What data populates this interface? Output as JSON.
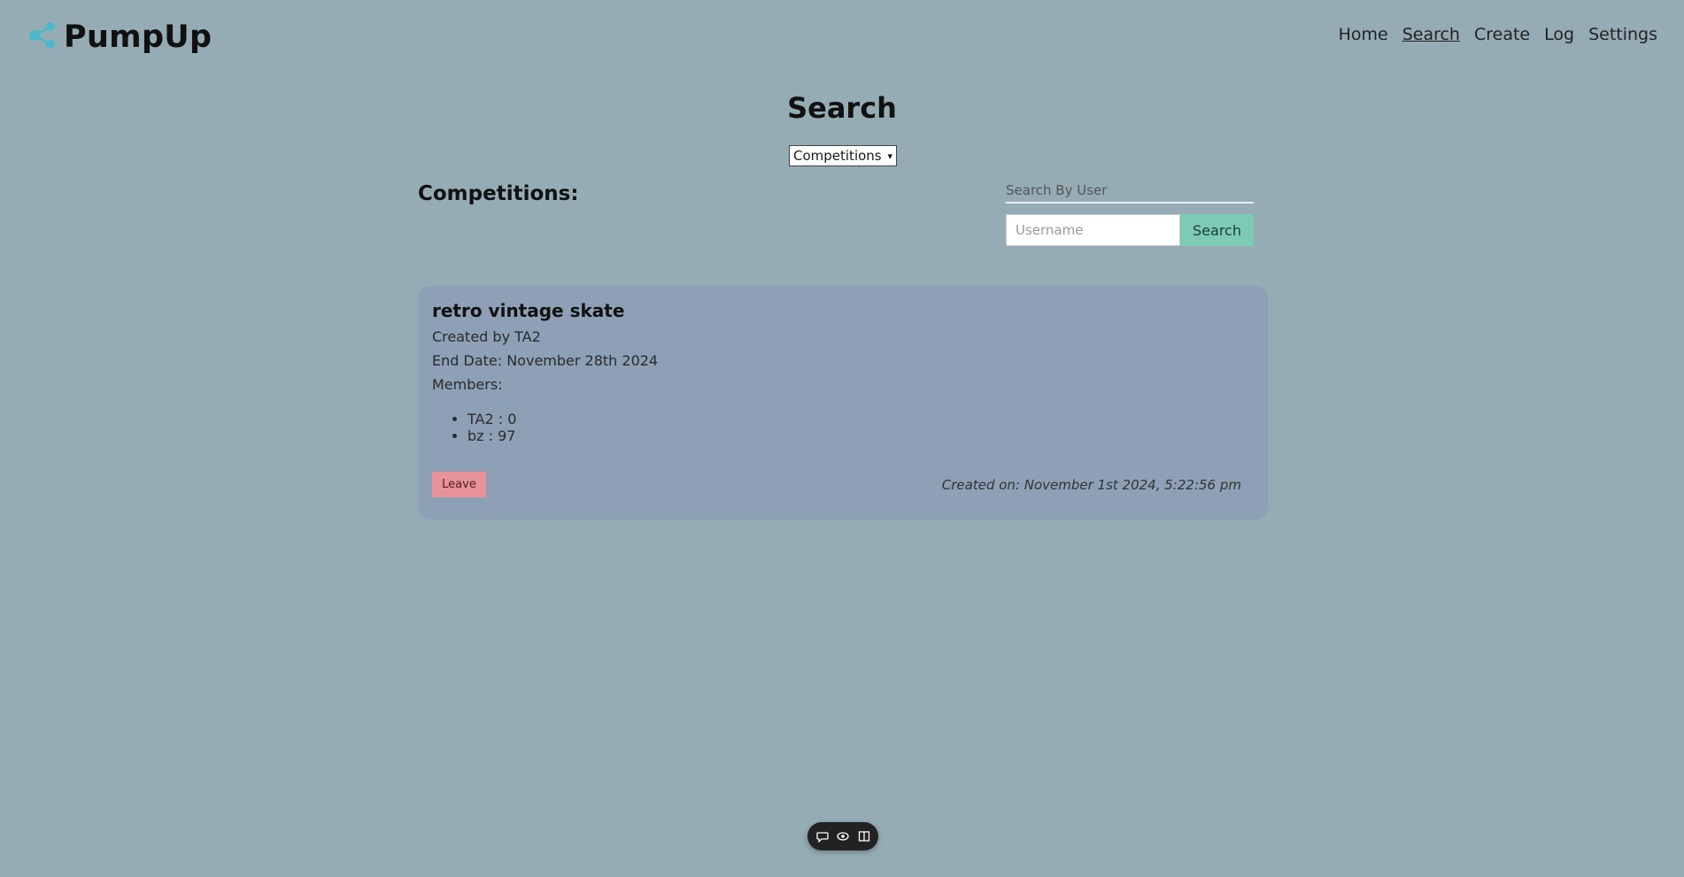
{
  "header": {
    "app_name": "PumpUp",
    "logo_icon": "share-icon",
    "brand_color": "#4ab8c9",
    "nav": [
      {
        "label": "Home",
        "active": false
      },
      {
        "label": "Search",
        "active": true
      },
      {
        "label": "Create",
        "active": false
      },
      {
        "label": "Log",
        "active": false
      },
      {
        "label": "Settings",
        "active": false
      }
    ]
  },
  "page": {
    "title": "Search",
    "type_select": {
      "selected": "Competitions"
    },
    "section_heading": "Competitions:"
  },
  "search_user": {
    "label": "Search By User",
    "placeholder": "Username",
    "value": "",
    "button_label": "Search",
    "button_color": "#7dcbb4"
  },
  "competitions": [
    {
      "name": "retro vintage skate",
      "created_by": "Created by TA2",
      "end_date": "End Date: November 28th 2024",
      "members_label": "Members:",
      "members": [
        "TA2 : 0",
        "bz : 97"
      ],
      "action_label": "Leave",
      "action_color": "#e8939a",
      "created_on": "Created on: November 1st 2024, 5:22:56 pm"
    }
  ],
  "toolbar": {
    "icons": [
      "comment-icon",
      "eye-icon",
      "panel-icon"
    ]
  }
}
